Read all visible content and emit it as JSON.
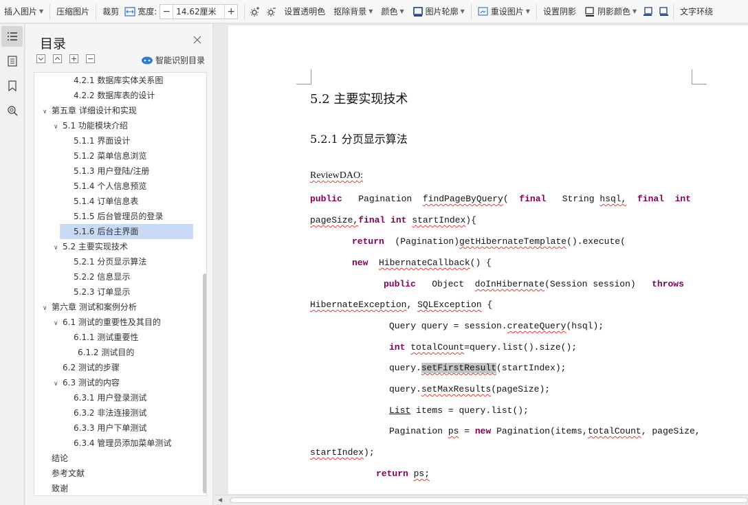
{
  "toolbar": {
    "insert_image": "插入图片",
    "compress_image": "压缩图片",
    "crop": "裁剪",
    "width_label": "宽度:",
    "width_value": "14.62厘米",
    "set_transparent": "设置透明色",
    "remove_bg": "抠除背景",
    "color": "颜色",
    "image_outline": "图片轮廓",
    "reset_image": "重设图片",
    "set_shadow": "设置阴影",
    "shadow_color": "阴影颜色",
    "text_wrap": "文字环绕"
  },
  "toc": {
    "title": "目录",
    "smart_label": "智能识别目录",
    "items": [
      {
        "label": "4.2.1 数据库实体关系图"
      },
      {
        "label": "4.2.2 数据库表的设计"
      },
      {
        "label": "第五章 详细设计和实现"
      },
      {
        "label": "5.1 功能模块介绍"
      },
      {
        "label": "5.1.1 界面设计"
      },
      {
        "label": "5.1.2 菜单信息浏览"
      },
      {
        "label": "5.1.3 用户登陆/注册"
      },
      {
        "label": "5.1.4 个人信息预览"
      },
      {
        "label": "5.1.4 订单信息表"
      },
      {
        "label": "5.1.5 后台管理员的登录"
      },
      {
        "label": "5.1.6 后台主界面"
      },
      {
        "label": "5.2 主要实现技术"
      },
      {
        "label": "5.2.1 分页显示算法"
      },
      {
        "label": "5.2.2 信息显示"
      },
      {
        "label": "5.2.3 订单显示"
      },
      {
        "label": "第六章 测试和案例分析"
      },
      {
        "label": "6.1 测试的重要性及其目的"
      },
      {
        "label": "6.1.1 测试重要性"
      },
      {
        "label": "6.1.2 测试目的"
      },
      {
        "label": "6.2 测试的步骤"
      },
      {
        "label": "6.3 测试的内容"
      },
      {
        "label": "6.3.1 用户登录测试"
      },
      {
        "label": "6.3.2 非法连接测试"
      },
      {
        "label": "6.3.3 用户下单测试"
      },
      {
        "label": "6.3.4 管理员添加菜单测试"
      },
      {
        "label": "结论"
      },
      {
        "label": "参考文献"
      },
      {
        "label": "致谢"
      }
    ]
  },
  "document": {
    "heading_2": "5.2 主要实现技术",
    "heading_3": "5.2.1 分页显示算法",
    "review_label": "ReviewDAO:",
    "code": {
      "l1_public": "public",
      "l1_pagination": "Pagination",
      "l1_method": "findPageByQuery",
      "l1_paren": "(",
      "l1_final1": "final",
      "l1_string": "String",
      "l1_hsql": "hsql,",
      "l1_final2": "final",
      "l1_int": "int",
      "l2_pagesize": "pageSize,",
      "l2_final": "final",
      "l2_int": "int",
      "l2_startindex": "startIndex",
      "l2_tail": "){",
      "l3_return": "return",
      "l3_cast": "(Pagination)",
      "l3_method": "getHibernateTemplate",
      "l3_tail": "().execute(",
      "l4_new": "new",
      "l4_callback": "HibernateCallback",
      "l4_tail": "() {",
      "l5_public": "public",
      "l5_object": "Object",
      "l5_method": "doInHibernate",
      "l5_args": "(Session session)",
      "l5_throws": "throws",
      "l6_exc1": "HibernateException",
      "l6_comma": ",",
      "l6_exc2": "SQLException",
      "l6_tail": "{",
      "l7_head": "Query query  =  session.",
      "l7_method": "createQuery",
      "l7_tail": "(hsql);",
      "l8_int": "int",
      "l8_var": "totalCount",
      "l8_tail": "=query.list().size();",
      "l9_head": "query.",
      "l9_method": "setFirstResult",
      "l9_tail": "(startIndex);",
      "l10_head": "query.",
      "l10_method": "setMaxResults",
      "l10_tail": "(pageSize);",
      "l11_list": "List",
      "l11_tail": "items  = query.list();",
      "l12_head": "Pagination",
      "l12_ps": "ps",
      "l12_eq": "=",
      "l12_new": "new",
      "l12_pag": "Pagination(items,",
      "l12_total": "totalCount",
      "l12_pagesize": ", pageSize,",
      "l13_startindex": "startIndex",
      "l13_tail": ");",
      "l14_return": "return",
      "l14_ps": "ps;"
    }
  },
  "colors": {
    "keyword": "#7f0055",
    "selected_toc": "#c9daf4",
    "spell_underline": "#e53935",
    "smart_icon": "#2f7bd8"
  }
}
